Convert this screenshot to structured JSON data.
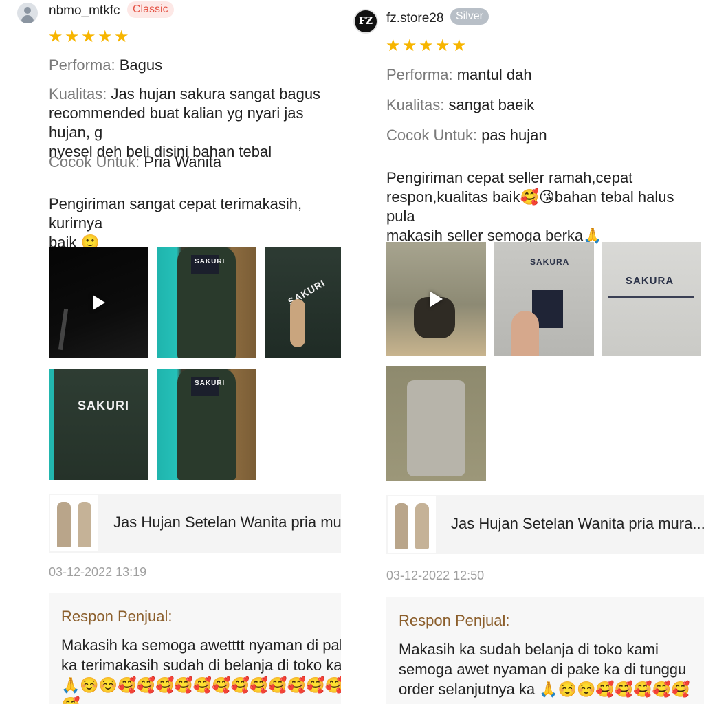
{
  "left": {
    "username": "nbmo_mtkfc",
    "badge": "Classic",
    "rating": 5,
    "performa_label": "Performa:",
    "performa_value": "Bagus",
    "kualitas_label": "Kualitas:",
    "kualitas_value": "Jas hujan sakura sangat bagus\nrecommended buat kalian yg nyari jas hujan, g\nnyesel deh beli disini bahan tebal",
    "cocok_label": "Cocok Untuk:",
    "cocok_value": "Pria Wanita",
    "comment": "Pengiriman sangat cepat terimakasih, kurirnya\nbaik 🙂",
    "product_name": "Jas Hujan Setelan Wanita pria mura",
    "date": "03-12-2022 13:19",
    "reply_title": "Respon Penjual:",
    "reply_text": "Makasih ka semoga awetttt nyaman di pake\nka terimakasih sudah di belanja di toko kam\n🙏☺️☺️🥰🥰🥰🥰🥰🥰🥰🥰🥰🥰🥰🥰🥰",
    "photo_label": "SAKURI"
  },
  "right": {
    "username": "fz.store28",
    "avatar_text": "FZ",
    "badge": "Silver",
    "rating": 5,
    "performa_label": "Performa:",
    "performa_value": "mantul dah",
    "kualitas_label": "Kualitas:",
    "kualitas_value": "sangat baeik",
    "cocok_label": "Cocok Untuk:",
    "cocok_value": "pas hujan",
    "comment": "Pengiriman cepat seller ramah,cepat\nrespon,kualitas baik🥰😘bahan tebal halus pula\nmakasih seller semoga berka🙏",
    "product_name": "Jas Hujan Setelan Wanita pria mura...",
    "date": "03-12-2022 12:50",
    "reply_title": "Respon Penjual:",
    "reply_text": "Makasih ka sudah belanja di toko kami\nsemoga awet nyaman di pake ka di tunggu\norder selanjutnya ka 🙏☺️☺️🥰🥰🥰🥰🥰",
    "photo_label": "SAKURA"
  },
  "icons": {
    "star": "star-icon",
    "play": "play-icon",
    "avatar_default": "user-avatar-icon"
  },
  "colors": {
    "star": "#f7b500",
    "badge_classic_bg": "#fde8e6",
    "badge_classic_text": "#e45446",
    "badge_silver_bg": "#b8bfc7",
    "reply_title": "#8b5e2b"
  }
}
